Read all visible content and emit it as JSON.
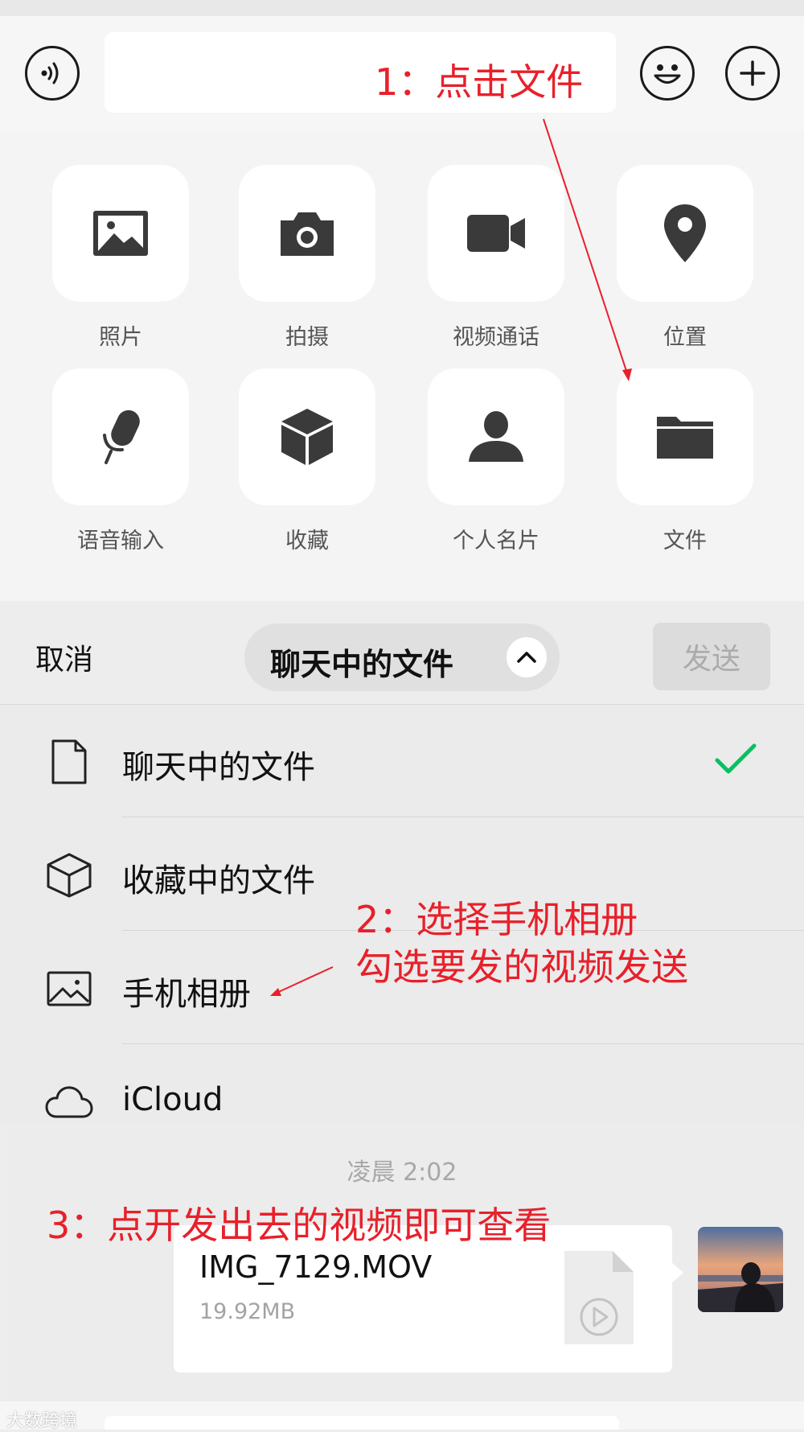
{
  "tools": {
    "row1": [
      {
        "label": "照片",
        "icon": "photo-icon"
      },
      {
        "label": "拍摄",
        "icon": "camera-icon"
      },
      {
        "label": "视频通话",
        "icon": "video-call-icon"
      },
      {
        "label": "位置",
        "icon": "location-icon"
      }
    ],
    "row2": [
      {
        "label": "语音输入",
        "icon": "microphone-icon"
      },
      {
        "label": "收藏",
        "icon": "cube-icon"
      },
      {
        "label": "个人名片",
        "icon": "contact-card-icon"
      },
      {
        "label": "文件",
        "icon": "folder-icon"
      }
    ]
  },
  "picker": {
    "cancel_label": "取消",
    "title": "聊天中的文件",
    "send_label": "发送",
    "options": [
      {
        "label": "聊天中的文件",
        "icon": "document-icon",
        "selected": true
      },
      {
        "label": "收藏中的文件",
        "icon": "cube-outline-icon",
        "selected": false
      },
      {
        "label": "手机相册",
        "icon": "image-outline-icon",
        "selected": false
      },
      {
        "label": "iCloud",
        "icon": "cloud-icon",
        "selected": false
      }
    ]
  },
  "chat": {
    "timestamp": "凌晨 2:02",
    "message": {
      "file_name": "IMG_7129.MOV",
      "file_size": "19.92MB"
    }
  },
  "annotations": {
    "step1": "1：点击文件",
    "step2_line1": "2：选择手机相册",
    "step2_line2": "勾选要发的视频发送",
    "step3": "3：点开发出去的视频即可查看"
  },
  "watermark": "大数跨境",
  "colors": {
    "annotation": "#e8202a",
    "checkmark": "#07c160"
  }
}
